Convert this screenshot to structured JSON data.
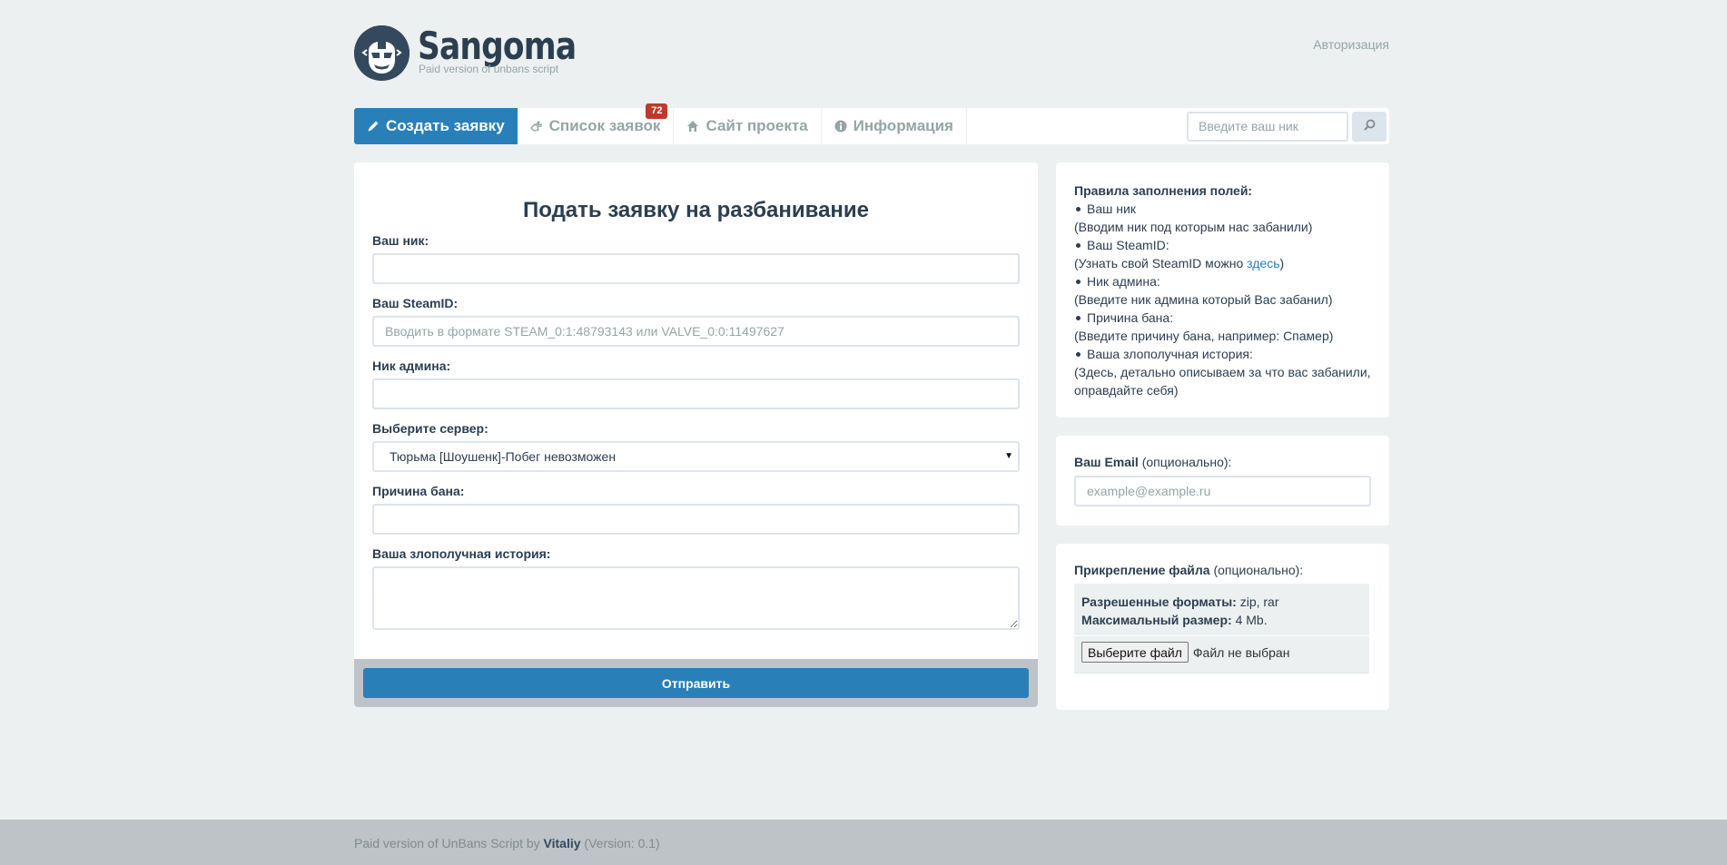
{
  "header": {
    "brand": "Sangoma",
    "tagline": "Paid version of unbans script",
    "auth_link": "Авторизация"
  },
  "nav": {
    "items": [
      {
        "label": "Создать заявку",
        "icon": "pencil-icon"
      },
      {
        "label": "Список заявок",
        "icon": "hand-icon",
        "badge": "72"
      },
      {
        "label": "Сайт проекта",
        "icon": "home-icon"
      },
      {
        "label": "Информация",
        "icon": "info-icon"
      }
    ],
    "search_placeholder": "Введите ваш ник",
    "search_icon": "search-icon"
  },
  "form": {
    "title": "Подать заявку на разбанивание",
    "nick_label": "Ваш ник:",
    "nick_value": "",
    "steamid_label": "Ваш SteamID:",
    "steamid_placeholder": "Вводить в формате STEAM_0:1:48793143 или VALVE_0:0:11497627",
    "admin_label": "Ник админа:",
    "admin_value": "",
    "server_label": "Выберите сервер:",
    "server_selected": "Тюрьма [Шоушенк]-Побег невозможен",
    "reason_label": "Причина бана:",
    "reason_value": "",
    "story_label": "Ваша злополучная история:",
    "story_value": "",
    "submit_label": "Отправить"
  },
  "rules": {
    "heading": "Правила заполнения полей:",
    "items": [
      {
        "title": "Ваш ник",
        "note": "(Вводим ник под которым нас забанили)"
      },
      {
        "title": "Ваш SteamID:",
        "note_prefix": "(Узнать свой SteamID можно ",
        "note_link": "здесь",
        "note_suffix": ")"
      },
      {
        "title": "Ник админа:",
        "note": "(Введите ник админа который Вас забанил)"
      },
      {
        "title": "Причина бана:",
        "note": "(Введите причину бана, например: Спамер)"
      },
      {
        "title": "Ваша злополучная история:",
        "note": "(Здесь, детально описываем за что вас забанили, оправдайте себя)"
      }
    ]
  },
  "email": {
    "label": "Ваш Email",
    "optional": " (опционально):",
    "placeholder": "example@example.ru"
  },
  "file": {
    "label": "Прикрепление файла",
    "optional": " (опционально):",
    "formats_label": "Разрешенные форматы:",
    "formats_value": " zip, rar",
    "size_label": "Максимальный размер:",
    "size_value": " 4 Mb.",
    "button_label": "Выберите файл",
    "status": "Файл не выбран"
  },
  "footer": {
    "prefix": "Paid version of UnBans Script by ",
    "author": "Vitaliy",
    "suffix": " (Version: 0.1)"
  },
  "colors": {
    "primary": "#2980b9",
    "text": "#2c3e50",
    "muted": "#95a5a6",
    "background": "#ecf0f1",
    "badge": "#c0392b"
  }
}
